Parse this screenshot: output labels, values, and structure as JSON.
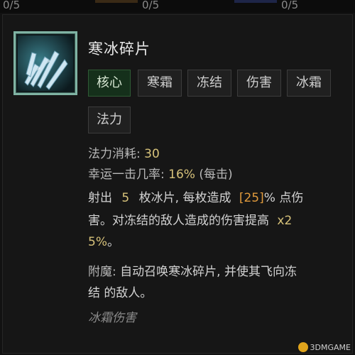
{
  "top_counts": [
    "0/5",
    "0/5",
    "0/5"
  ],
  "skill": {
    "name": "寒冰碎片",
    "icon": "ice-shards-icon",
    "tags": [
      "核心",
      "寒霜",
      "冻结",
      "伤害",
      "冰霜",
      "法力"
    ],
    "cost_label": "法力消耗:",
    "cost_value": "30",
    "lucky_label": "幸运一击几率:",
    "lucky_value": "16%",
    "lucky_note": "(每击)",
    "desc_line1_a": "射出",
    "desc_line1_num": "5",
    "desc_line1_b": "枚冰片, 每枚造成",
    "desc_line1_dmg": "[25]",
    "desc_line1_c": "% 点伤",
    "desc_line2_a": "害。对冻结的敌人造成的伤害提高",
    "desc_line2_mult": "x2",
    "desc_line3_mult": "5%",
    "desc_line3_end": "。",
    "enchant_label": "附魔:",
    "enchant_line1": "自动召唤寒冰碎片, 并使其飞向冻",
    "enchant_line2": "结 的敌人。",
    "damage_type": "冰霜伤害"
  },
  "watermark": "3DMGAME",
  "colors": {
    "core_tag_bg": "#15301b",
    "highlight_gold": "#d7c27a",
    "highlight_orange": "#e09a3c",
    "icon_border": "#7fb3a3"
  }
}
